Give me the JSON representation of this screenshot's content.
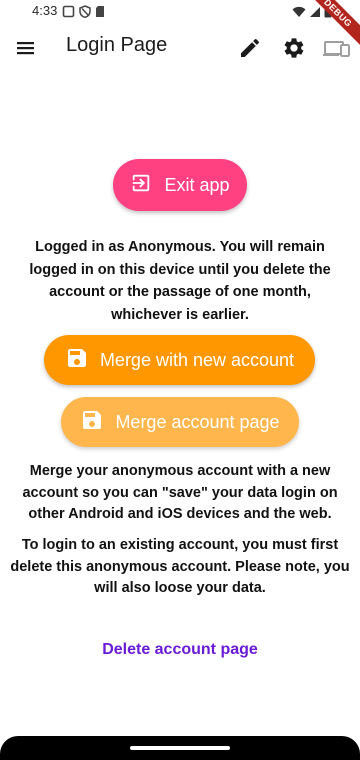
{
  "status_bar": {
    "time": "4:33",
    "debug_banner": "DEBUG"
  },
  "app_bar": {
    "title": "Login Page",
    "icons": [
      "menu-icon",
      "edit-icon",
      "settings-icon",
      "devices-icon"
    ]
  },
  "exit_button": {
    "label": "Exit app",
    "color": "#ff4081",
    "icon": "exit-icon"
  },
  "info_text": "Logged in as Anonymous. You will remain logged in on this device until you delete the account or the passage of one month, whichever is earlier.",
  "merge_new_button": {
    "label": "Merge with new account",
    "color": "#ff9800",
    "icon": "save-icon"
  },
  "merge_page_button": {
    "label": "Merge account page",
    "color": "#ffb74d",
    "icon": "save-icon"
  },
  "merge_description": "Merge your anonymous account with a new account so you can \"save\" your data login on other Android and iOS devices and the web.",
  "login_description": "To login to an existing account, you must first delete this anonymous account. Please note, you will also loose your data.",
  "delete_link": {
    "label": "Delete account page",
    "color": "#6a1bd6"
  }
}
